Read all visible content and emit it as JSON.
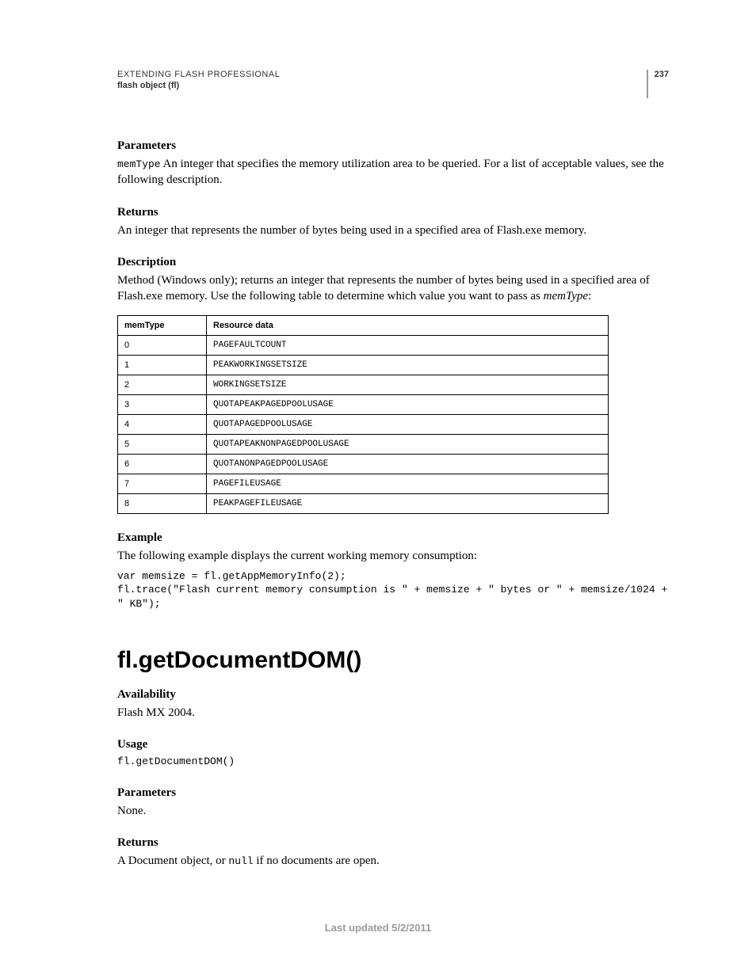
{
  "header": {
    "title": "EXTENDING FLASH PROFESSIONAL",
    "subtitle": "flash object (fl)",
    "page_number": "237"
  },
  "sections": {
    "parameters1": {
      "heading": "Parameters",
      "code_term": "memType",
      "body": "  An integer that specifies the memory utilization area to be queried. For a list of acceptable values, see the following description."
    },
    "returns1": {
      "heading": "Returns",
      "body": "An integer that represents the number of bytes being used in a specified area of Flash.exe memory."
    },
    "description1": {
      "heading": "Description",
      "body_pre": "Method (Windows only); returns an integer that represents the number of bytes being used in a specified area of Flash.exe memory. Use the following table to determine which value you want to pass as ",
      "body_ital": "memType",
      "body_post": ":"
    },
    "table": {
      "col1_header": "memType",
      "col2_header": "Resource data",
      "rows": [
        {
          "m": "0",
          "r": "PAGEFAULTCOUNT"
        },
        {
          "m": "1",
          "r": "PEAKWORKINGSETSIZE"
        },
        {
          "m": "2",
          "r": "WORKINGSETSIZE"
        },
        {
          "m": "3",
          "r": "QUOTAPEAKPAGEDPOOLUSAGE"
        },
        {
          "m": "4",
          "r": "QUOTAPAGEDPOOLUSAGE"
        },
        {
          "m": "5",
          "r": "QUOTAPEAKNONPAGEDPOOLUSAGE"
        },
        {
          "m": "6",
          "r": "QUOTANONPAGEDPOOLUSAGE"
        },
        {
          "m": "7",
          "r": "PAGEFILEUSAGE"
        },
        {
          "m": "8",
          "r": "PEAKPAGEFILEUSAGE"
        }
      ]
    },
    "example1": {
      "heading": "Example",
      "body": "The following example displays the current working memory consumption:",
      "code": "var memsize = fl.getAppMemoryInfo(2);\nfl.trace(\"Flash current memory consumption is \" + memsize + \" bytes or \" + memsize/1024 + \" KB\");"
    },
    "method_title": "fl.getDocumentDOM()",
    "availability": {
      "heading": "Availability",
      "body": "Flash MX 2004."
    },
    "usage": {
      "heading": "Usage",
      "code": "fl.getDocumentDOM()"
    },
    "parameters2": {
      "heading": "Parameters",
      "body": "None."
    },
    "returns2": {
      "heading": "Returns",
      "body_pre": "A Document object, or ",
      "body_code": "null",
      "body_post": " if no documents are open."
    }
  },
  "footer": "Last updated 5/2/2011"
}
